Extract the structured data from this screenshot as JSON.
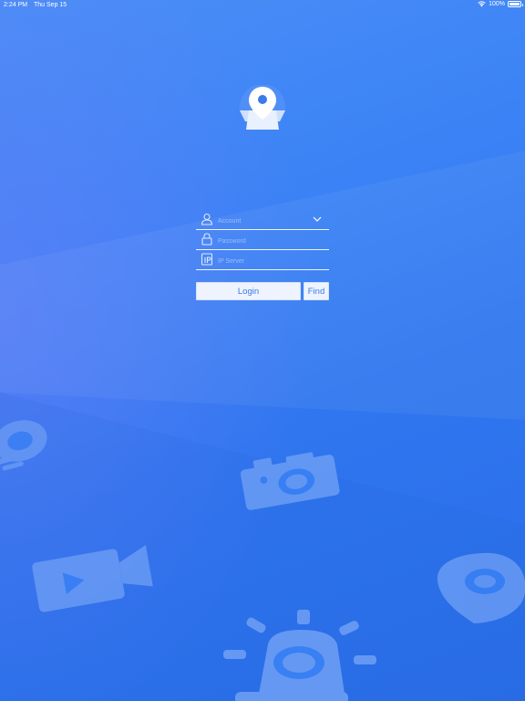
{
  "status_bar": {
    "time": "2:24 PM",
    "date": "Thu Sep 15",
    "battery": "100%",
    "icons": [
      "wifi-icon",
      "battery-icon"
    ]
  },
  "logo": {
    "icon": "location-pin-map-icon"
  },
  "form": {
    "account": {
      "placeholder": "Account",
      "value": "",
      "icon": "user-icon",
      "dropdown_icon": "chevron-down-icon"
    },
    "password": {
      "placeholder": "Password",
      "value": "",
      "icon": "lock-icon"
    },
    "ip_server": {
      "placeholder": "IP Server",
      "value": "",
      "icon": "ip-icon"
    }
  },
  "buttons": {
    "login_label": "Login",
    "find_label": "Find"
  },
  "background_icons": [
    "microphone-icon",
    "camera-icon",
    "video-camera-icon",
    "location-pin-icon",
    "alarm-light-icon"
  ],
  "colors": {
    "background": "#3a82f5",
    "button_bg": "#eef3fd",
    "button_text": "#3a7bea"
  }
}
